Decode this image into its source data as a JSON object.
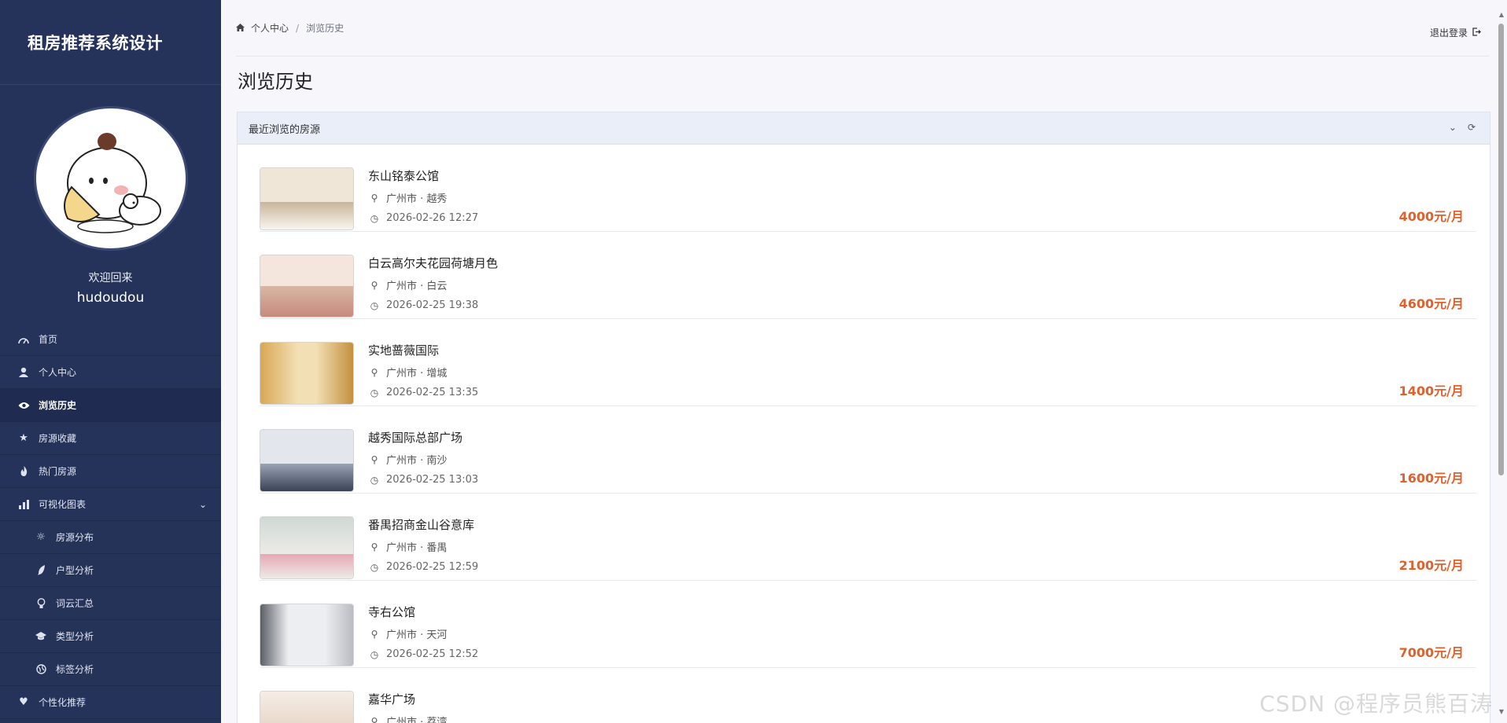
{
  "app": {
    "title": "租房推荐系统设计"
  },
  "user": {
    "welcome": "欢迎回来",
    "name": "hudoudou"
  },
  "menu": [
    {
      "label": "首页",
      "icon": "dashboard-icon"
    },
    {
      "label": "个人中心",
      "icon": "user-icon"
    },
    {
      "label": "浏览历史",
      "icon": "eye-icon",
      "active": true
    },
    {
      "label": "房源收藏",
      "icon": "star-icon"
    },
    {
      "label": "热门房源",
      "icon": "fire-icon"
    },
    {
      "label": "可视化图表",
      "icon": "bar-chart-icon",
      "expanded": true
    },
    {
      "label": "房源分布",
      "icon": "sun-icon",
      "sub": true
    },
    {
      "label": "户型分析",
      "icon": "feather-icon",
      "sub": true
    },
    {
      "label": "词云汇总",
      "icon": "lightbulb-icon",
      "sub": true
    },
    {
      "label": "类型分析",
      "icon": "graduation-cap-icon",
      "sub": true
    },
    {
      "label": "标签分析",
      "icon": "globe-icon",
      "sub": true
    },
    {
      "label": "个性化推荐",
      "icon": "heart-icon"
    }
  ],
  "breadcrumb": {
    "home": "个人中心",
    "current": "浏览历史"
  },
  "header": {
    "logout": "退出登录"
  },
  "page": {
    "title": "浏览历史"
  },
  "panel": {
    "title": "最近浏览的房源"
  },
  "history": [
    {
      "title": "东山铭泰公馆",
      "location": "广州市 · 越秀",
      "time": "2026-02-26 12:27",
      "price": "4000元/月",
      "palette": [
        "#c9b49a",
        "#efe6d8",
        "#f8f5ee"
      ]
    },
    {
      "title": "白云高尔夫花园荷塘月色",
      "location": "广州市 · 白云",
      "time": "2026-02-25 19:38",
      "price": "4600元/月",
      "palette": [
        "#d8b7a4",
        "#f4e5dd",
        "#c68a7d"
      ]
    },
    {
      "title": "实地蔷薇国际",
      "location": "广州市 · 增城",
      "time": "2026-02-25 13:35",
      "price": "1400元/月",
      "palette": [
        "#d9a755",
        "#f2dfb4",
        "#c4903f"
      ]
    },
    {
      "title": "越秀国际总部广场",
      "location": "广州市 · 南沙",
      "time": "2026-02-25 13:03",
      "price": "1600元/月",
      "palette": [
        "#9aa4b4",
        "#e3e6ec",
        "#3a4356"
      ]
    },
    {
      "title": "番禺招商金山谷意库",
      "location": "广州市 · 番禺",
      "time": "2026-02-25 12:59",
      "price": "2100元/月",
      "palette": [
        "#cfd9d4",
        "#ecebe6",
        "#e7a7b4"
      ]
    },
    {
      "title": "寺右公馆",
      "location": "广州市 · 天河",
      "time": "2026-02-25 12:52",
      "price": "7000元/月",
      "palette": [
        "#b9bcc2",
        "#eceef1",
        "#5b5f66"
      ]
    },
    {
      "title": "嘉华广场",
      "location": "广州市 · 荔湾",
      "time": "",
      "price": "",
      "palette": [
        "#e8d6c8",
        "#f5ede6",
        "#c9a58f"
      ]
    }
  ],
  "watermark": "CSDN @程序员熊百涛"
}
